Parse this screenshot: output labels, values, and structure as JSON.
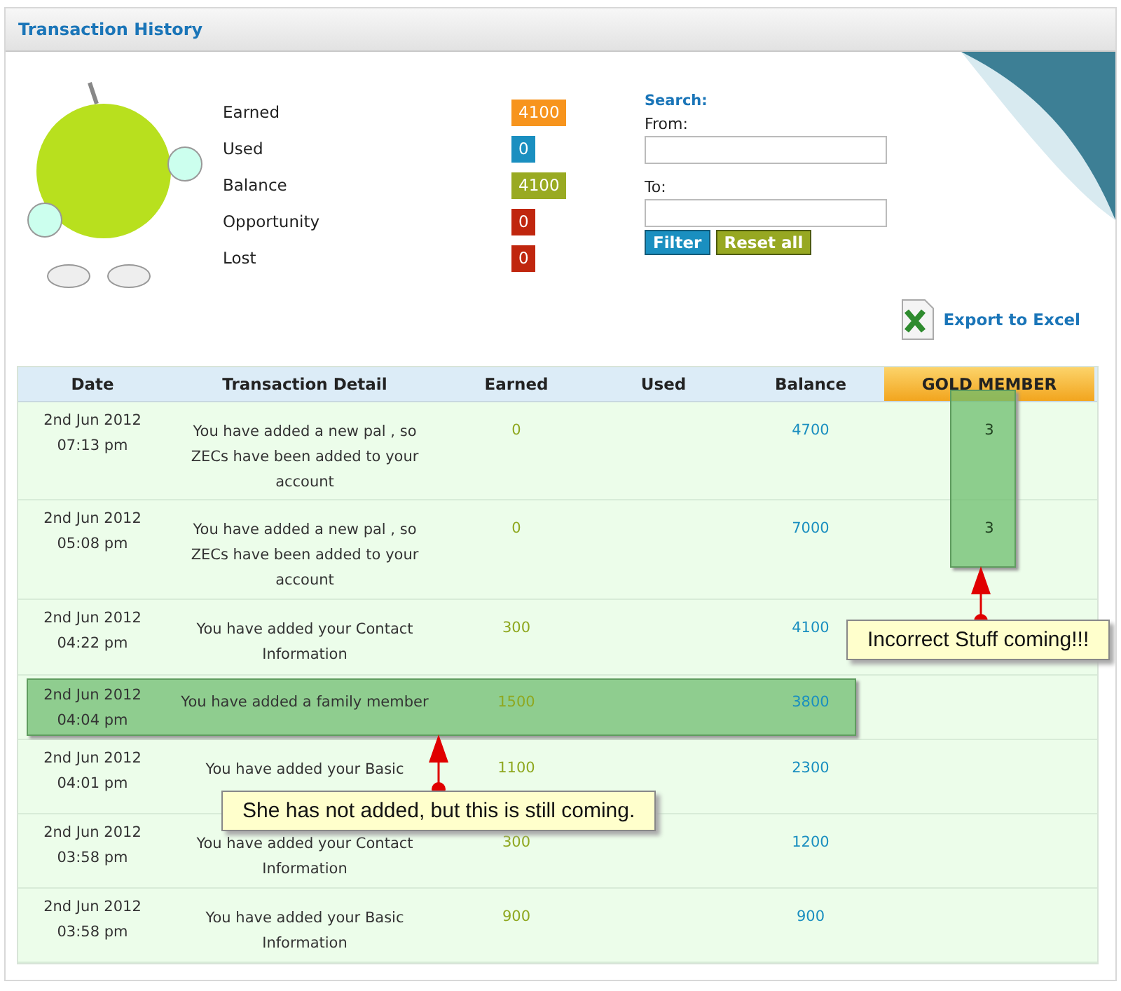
{
  "panel": {
    "title": "Transaction History"
  },
  "stats": [
    {
      "label": "Earned",
      "value": "4100",
      "color": "#f7941d"
    },
    {
      "label": "Used",
      "value": "0",
      "color": "#1a8fc0"
    },
    {
      "label": "Balance",
      "value": "4100",
      "color": "#99aa22"
    },
    {
      "label": "Opportunity",
      "value": "0",
      "color": "#c0260e"
    },
    {
      "label": "Lost",
      "value": "0",
      "color": "#c0260e"
    }
  ],
  "search": {
    "title": "Search:",
    "fields": [
      {
        "label": "From:"
      },
      {
        "label": "To:"
      }
    ],
    "buttons": [
      {
        "label": "Filter",
        "kind": "primary"
      },
      {
        "label": "Reset all",
        "kind": "secondary"
      }
    ]
  },
  "export": {
    "label": "Export to Excel"
  },
  "table": {
    "columns": [
      {
        "label": "Date",
        "kind": "plain",
        "marked": false
      },
      {
        "label": "Transaction Detail",
        "kind": "plain",
        "marked": false
      },
      {
        "label": "Earned",
        "kind": "plain",
        "marked": false
      },
      {
        "label": "Used",
        "kind": "plain",
        "marked": false
      },
      {
        "label": "Balance",
        "kind": "plain",
        "marked": false
      },
      {
        "label": "GOLD MEMBER",
        "kind": "gold",
        "marked": true
      }
    ],
    "rows": [
      {
        "date": "2nd Jun 2012",
        "time": "07:13 pm",
        "detail": "You have added a new pal , so ZECs have been added to your account",
        "earned": "0",
        "balance": "4700",
        "gold": "3",
        "marked": false
      },
      {
        "date": "2nd Jun 2012",
        "time": "05:08 pm",
        "detail": "You have added a new pal , so ZECs have been added to your account",
        "earned": "0",
        "balance": "7000",
        "gold": "3",
        "marked": false
      },
      {
        "date": "2nd Jun 2012",
        "time": "04:22 pm",
        "detail": "You have added your Contact Information",
        "earned": "300",
        "balance": "4100",
        "marked": false
      },
      {
        "date": "2nd Jun 2012",
        "time": "04:04 pm",
        "detail": "You have added a family member",
        "earned": "1500",
        "balance": "3800",
        "marked": true
      },
      {
        "date": "2nd Jun 2012",
        "time": "04:01 pm",
        "detail": "You have added your Basic",
        "earned": "1100",
        "balance": "2300",
        "marked": false
      },
      {
        "date": "2nd Jun 2012",
        "time": "03:58 pm",
        "detail": "You have added your Contact Information",
        "earned": "300",
        "balance": "1200",
        "marked": false
      },
      {
        "date": "2nd Jun 2012",
        "time": "03:58 pm",
        "detail": "You have added your Basic Information",
        "earned": "900",
        "balance": "900",
        "marked": false
      }
    ]
  },
  "annotations": [
    {
      "text": "Incorrect Stuff coming!!!"
    },
    {
      "text": "She has not added, but this is still coming."
    }
  ]
}
